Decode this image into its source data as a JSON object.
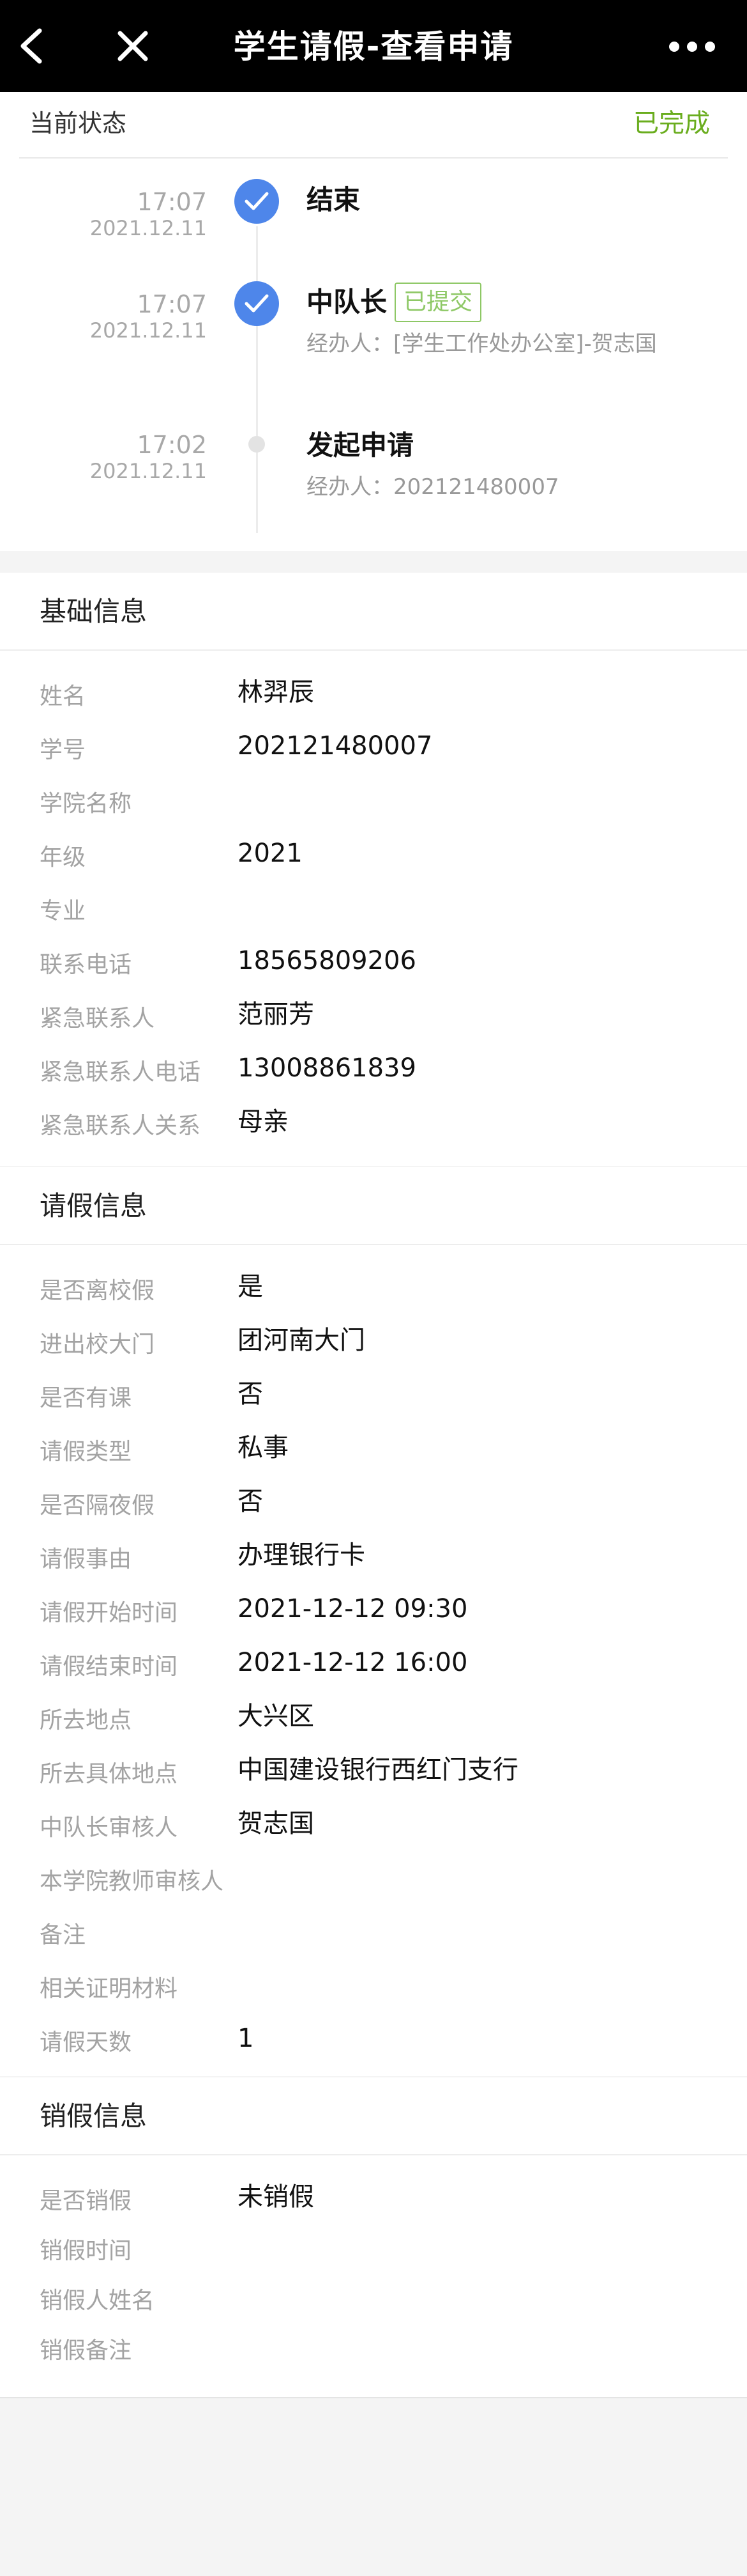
{
  "window": {
    "title": "学生请假-查看申请"
  },
  "status": {
    "label": "当前状态",
    "value": "已完成"
  },
  "timeline": [
    {
      "time": "17:07",
      "date": "2021.12.11",
      "name": "结束",
      "badge": "",
      "handler": "",
      "done": true
    },
    {
      "time": "17:07",
      "date": "2021.12.11",
      "name": "中队长",
      "badge": "已提交",
      "handler": "经办人：[学生工作处办公室]-贺志国",
      "done": true
    },
    {
      "time": "17:02",
      "date": "2021.12.11",
      "name": "发起申请",
      "badge": "",
      "handler": "经办人：202121480007",
      "done": false
    }
  ],
  "basic": {
    "title": "基础信息",
    "rows": [
      {
        "label": "姓名",
        "value": "林羿辰"
      },
      {
        "label": "学号",
        "value": "202121480007"
      },
      {
        "label": "学院名称",
        "value": ""
      },
      {
        "label": "年级",
        "value": "2021"
      },
      {
        "label": "专业",
        "value": ""
      },
      {
        "label": "联系电话",
        "value": "18565809206"
      },
      {
        "label": "紧急联系人",
        "value": "范丽芳"
      },
      {
        "label": "紧急联系人电话",
        "value": "13008861839"
      },
      {
        "label": "紧急联系人关系",
        "value": "母亲"
      }
    ]
  },
  "leave": {
    "title": "请假信息",
    "rows": [
      {
        "label": "是否离校假",
        "value": "是"
      },
      {
        "label": "进出校大门",
        "value": "团河南大门"
      },
      {
        "label": "是否有课",
        "value": "否"
      },
      {
        "label": "请假类型",
        "value": "私事"
      },
      {
        "label": "是否隔夜假",
        "value": "否"
      },
      {
        "label": "请假事由",
        "value": "办理银行卡"
      },
      {
        "label": "请假开始时间",
        "value": "2021-12-12 09:30"
      },
      {
        "label": "请假结束时间",
        "value": "2021-12-12 16:00"
      },
      {
        "label": "所去地点",
        "value": "大兴区"
      },
      {
        "label": "所去具体地点",
        "value": "中国建设银行西红门支行"
      },
      {
        "label": "中队长审核人",
        "value": "贺志国"
      },
      {
        "label": "本学院教师审核人",
        "value": ""
      },
      {
        "label": "备注",
        "value": ""
      },
      {
        "label": "相关证明材料",
        "value": ""
      },
      {
        "label": "请假天数",
        "value": "1"
      }
    ]
  },
  "cancel": {
    "title": "销假信息",
    "rows": [
      {
        "label": "是否销假",
        "value": "未销假"
      },
      {
        "label": "销假时间",
        "value": ""
      },
      {
        "label": "销假人姓名",
        "value": ""
      },
      {
        "label": "销假备注",
        "value": ""
      }
    ]
  },
  "colors": {
    "titlebar": "#000000",
    "status_done": "#6aad1e",
    "check_blue": "#4e86ea",
    "badge_green": "#8ec866",
    "label_gray": "#a3a3a3"
  }
}
